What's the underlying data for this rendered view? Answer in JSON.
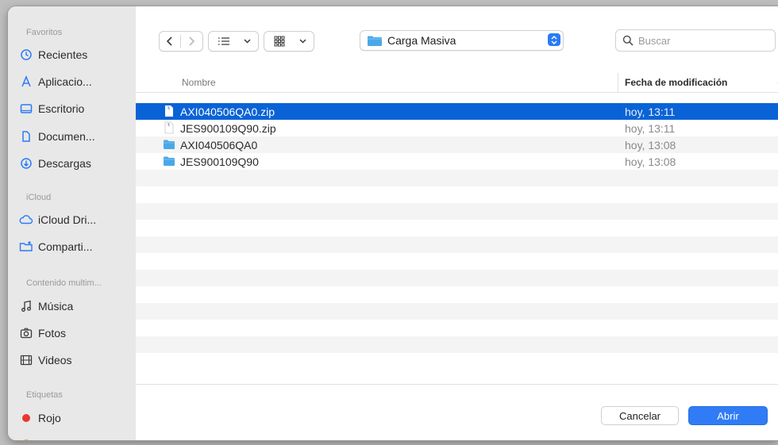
{
  "sidebar": {
    "sections": [
      {
        "title": "Favoritos",
        "items": [
          {
            "label": "Recientes",
            "icon": "clock-icon"
          },
          {
            "label": "Aplicacio...",
            "icon": "applications-icon"
          },
          {
            "label": "Escritorio",
            "icon": "desktop-icon"
          },
          {
            "label": "Documen...",
            "icon": "document-icon"
          },
          {
            "label": "Descargas",
            "icon": "downloads-icon"
          }
        ]
      },
      {
        "title": "iCloud",
        "items": [
          {
            "label": "iCloud Dri...",
            "icon": "cloud-icon"
          },
          {
            "label": "Comparti...",
            "icon": "shared-folder-icon"
          }
        ]
      },
      {
        "title": "Contenido multim...",
        "items": [
          {
            "label": "Música",
            "icon": "music-icon"
          },
          {
            "label": "Fotos",
            "icon": "camera-icon"
          },
          {
            "label": "Videos",
            "icon": "film-icon"
          }
        ]
      },
      {
        "title": "Etiquetas",
        "items": [
          {
            "label": "Rojo",
            "icon": "red-tag-icon",
            "color": "#e8382f"
          }
        ]
      }
    ]
  },
  "toolbar": {
    "location": "Carga Masiva",
    "search_placeholder": "Buscar"
  },
  "list": {
    "columns": {
      "name": "Nombre",
      "date": "Fecha de modificación"
    },
    "rows": [
      {
        "name": "AXI040506QA0.zip",
        "date": "hoy, 13:11",
        "type": "zip",
        "selected": true
      },
      {
        "name": "JES900109Q90.zip",
        "date": "hoy, 13:11",
        "type": "zip",
        "selected": false
      },
      {
        "name": "AXI040506QA0",
        "date": "hoy, 13:08",
        "type": "folder",
        "selected": false
      },
      {
        "name": "JES900109Q90",
        "date": "hoy, 13:08",
        "type": "folder",
        "selected": false
      }
    ]
  },
  "footer": {
    "cancel_label": "Cancelar",
    "open_label": "Abrir"
  },
  "colors": {
    "accent": "#2f7cf6",
    "selection": "#0a63d6",
    "folder": "#4aa8e8",
    "tag_red": "#e8382f",
    "tag_orange": "#f0a028"
  }
}
